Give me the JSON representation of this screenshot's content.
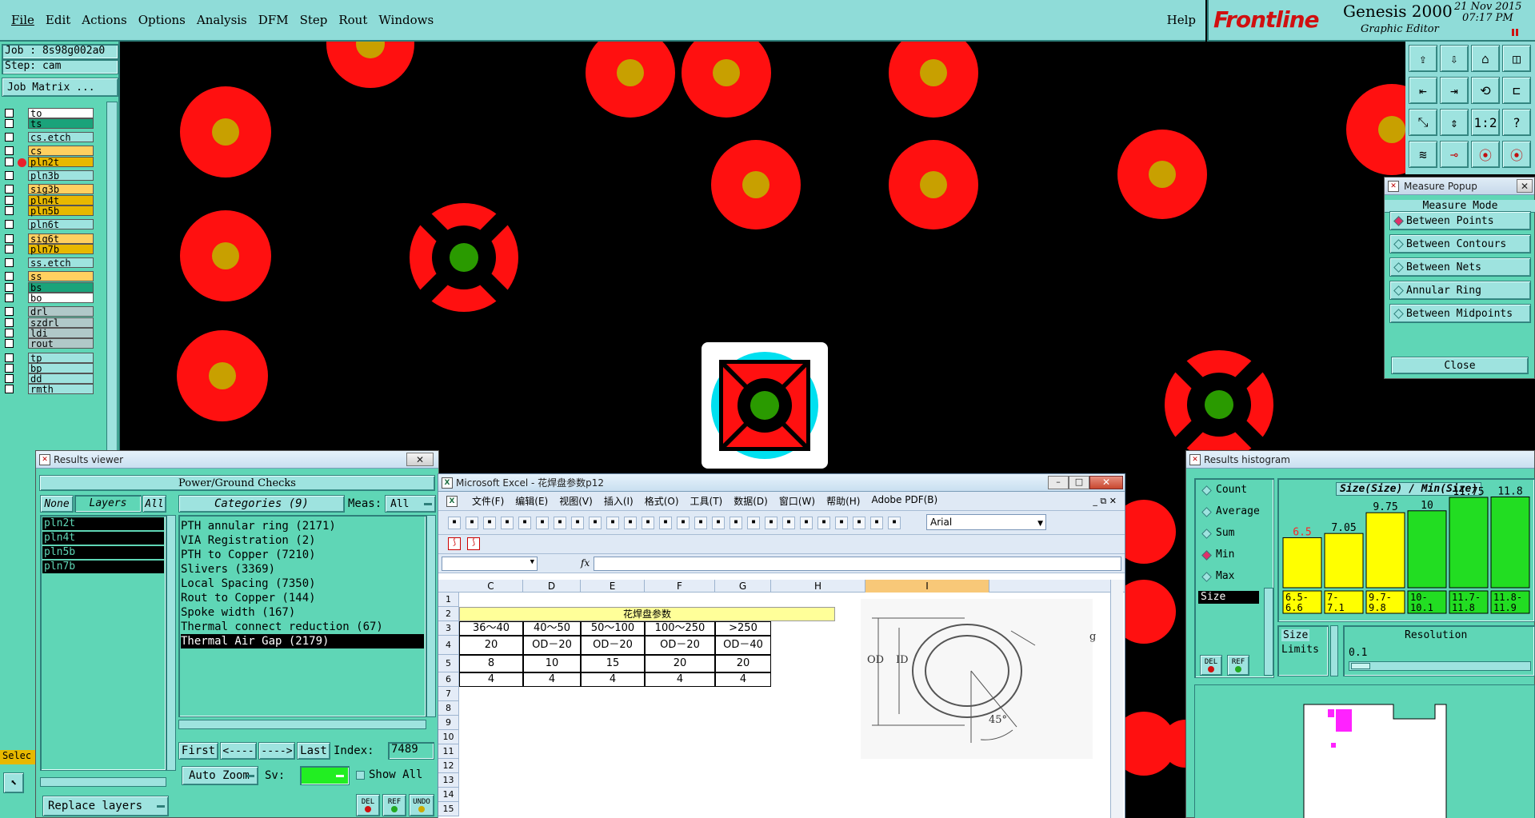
{
  "menu": {
    "file": "File",
    "edit": "Edit",
    "actions": "Actions",
    "options": "Options",
    "analysis": "Analysis",
    "dfm": "DFM",
    "step": "Step",
    "rout": "Rout",
    "windows": "Windows",
    "help": "Help"
  },
  "brand": {
    "logo": "Frontline",
    "product": "Genesis 2000",
    "subtitle": "Graphic Editor",
    "date": "21 Nov 2015",
    "time": "07:17 PM"
  },
  "job": {
    "job": "Job : 8s98g002a0",
    "step": "Step: cam",
    "matrix": "Job Matrix ..."
  },
  "layers": [
    {
      "name": "to",
      "color": "#ffffff"
    },
    {
      "name": "ts",
      "color": "#1aa37a"
    },
    {
      "name": "cs.etch",
      "color": "#9ee3df"
    },
    {
      "name": "cs",
      "color": "#ffd060"
    },
    {
      "name": "pln2t",
      "color": "#e8b800"
    },
    {
      "name": "pln3b",
      "color": "#9ee3df"
    },
    {
      "name": "sig3b",
      "color": "#ffd060"
    },
    {
      "name": "pln4t",
      "color": "#e8b800"
    },
    {
      "name": "pln5b",
      "color": "#e8b800"
    },
    {
      "name": "pln6t",
      "color": "#9ee3df"
    },
    {
      "name": "sig6t",
      "color": "#ffd060"
    },
    {
      "name": "pln7b",
      "color": "#e8b800"
    },
    {
      "name": "ss.etch",
      "color": "#9ee3df"
    },
    {
      "name": "ss",
      "color": "#ffd060"
    },
    {
      "name": "bs",
      "color": "#1aa37a"
    },
    {
      "name": "bo",
      "color": "#ffffff"
    },
    {
      "name": "drl",
      "color": "#b0c8c8"
    },
    {
      "name": "szdrl",
      "color": "#b0c8c8"
    },
    {
      "name": "ldi",
      "color": "#b0c8c8"
    },
    {
      "name": "rout",
      "color": "#b0c8c8"
    },
    {
      "name": "tp",
      "color": "#9ee3df"
    },
    {
      "name": "bp",
      "color": "#9ee3df"
    },
    {
      "name": "dd",
      "color": "#9ee3df"
    },
    {
      "name": "rmth",
      "color": "#9ee3df"
    }
  ],
  "results": {
    "title": "Results viewer",
    "header": "Power/Ground Checks",
    "none": "None",
    "layers_label": "Layers",
    "all": "All",
    "categories_label": "Categories (9)",
    "meas_label": "Meas:",
    "meas_value": "All",
    "layer_list": [
      "pln2t",
      "pln4t",
      "pln5b",
      "pln7b"
    ],
    "categories": [
      "PTH annular ring (2171)",
      "VIA Registration (2)",
      "PTH to Copper (7210)",
      "Slivers (3369)",
      "Local Spacing (7350)",
      "Rout to Copper (144)",
      "Spoke width (167)",
      "Thermal connect reduction (67)",
      "Thermal Air Gap (2179)"
    ],
    "first": "First",
    "prev": "<----",
    "next": "---->",
    "last": "Last",
    "index_label": "Index:",
    "index_value": "7489",
    "auto_zoom": "Auto Zoom",
    "sv": "Sv:",
    "show_all": "Show All",
    "replace_layers": "Replace layers",
    "del": "DEL",
    "ref": "REF",
    "undo": "UNDO",
    "select": "Selec"
  },
  "excel": {
    "title": "Microsoft Excel - 花焊盘参数p12",
    "menus": [
      "文件(F)",
      "编辑(E)",
      "视图(V)",
      "插入(I)",
      "格式(O)",
      "工具(T)",
      "数据(D)",
      "窗口(W)",
      "帮助(H)",
      "Adobe PDF(B)"
    ],
    "font": "Arial",
    "fx": "fx",
    "cols": [
      "C",
      "D",
      "E",
      "F",
      "G",
      "H",
      "I"
    ],
    "rows": [
      "1",
      "2",
      "3",
      "4",
      "5",
      "6",
      "7",
      "8",
      "9",
      "10",
      "11",
      "12",
      "13",
      "14",
      "15"
    ],
    "table_title": "花焊盘参数",
    "table": [
      [
        "36～40",
        "40～50",
        "50～100",
        "100～250",
        ">250"
      ],
      [
        "20",
        "OD－20",
        "OD－20",
        "OD－20",
        "OD－40"
      ],
      [
        "8",
        "10",
        "15",
        "20",
        "20"
      ],
      [
        "4",
        "4",
        "4",
        "4",
        "4"
      ]
    ],
    "diagram": {
      "od": "OD",
      "id": "ID",
      "g": "g",
      "angle": "45°"
    }
  },
  "measure": {
    "title": "Measure Popup",
    "mode": "Measure Mode",
    "options": [
      "Between Points",
      "Between Contours",
      "Between Nets",
      "Annular Ring",
      "Between Midpoints"
    ],
    "selected": 0,
    "close": "Close"
  },
  "histogram": {
    "title": "Results histogram",
    "options": [
      "Count",
      "Average",
      "Sum",
      "Min",
      "Max"
    ],
    "selected": 3,
    "list_item": "Size",
    "chart_title": "Size(Size) / Min(Size)",
    "size_label": "Size",
    "limits_label": "Limits",
    "resolution_label": "Resolution",
    "resolution_value": "0.1",
    "del": "DEL",
    "ref": "REF"
  },
  "chart_data": {
    "type": "bar",
    "title": "Size(Size) / Min(Size)",
    "categories": [
      "6.5-6.6",
      "7-7.1",
      "9.7-9.8",
      "10-10.1",
      "11.7-11.8",
      "11.8-11.9"
    ],
    "values": [
      6.5,
      7.05,
      9.75,
      10,
      11.75,
      11.8
    ],
    "value_labels": [
      "6.5",
      "7.05",
      "9.75",
      "10",
      "11.75",
      "11.8"
    ],
    "colors": [
      "#ffff00",
      "#ffff00",
      "#ffff00",
      "#22dd22",
      "#22dd22",
      "#22dd22"
    ],
    "label_colors": [
      "#ff2222",
      "#000000",
      "#000000",
      "#000000",
      "#000000",
      "#000000"
    ],
    "ylim": [
      0,
      13
    ]
  }
}
